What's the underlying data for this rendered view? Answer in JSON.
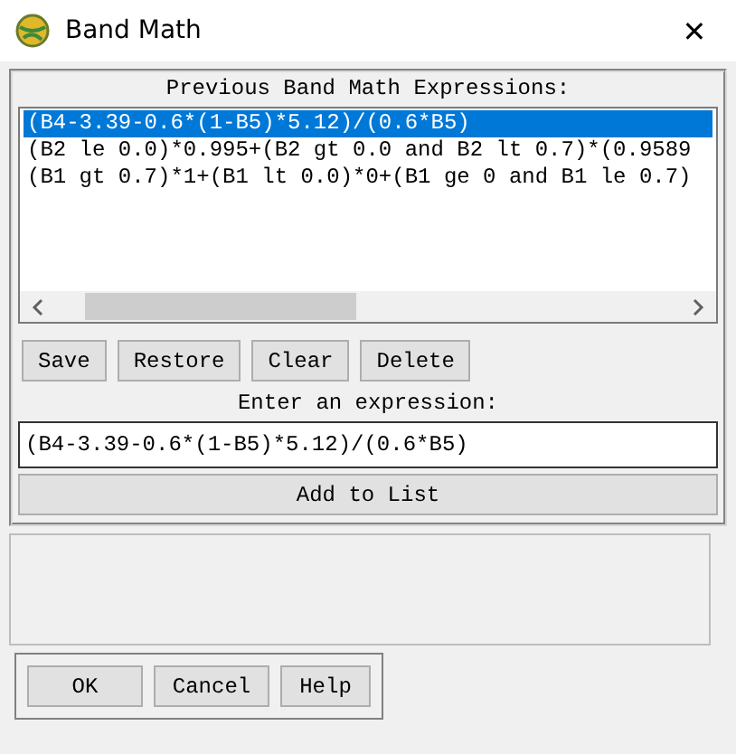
{
  "window": {
    "title": "Band Math",
    "close": "✕"
  },
  "history": {
    "label": "Previous Band Math Expressions:",
    "items": [
      {
        "text": "(B4-3.39-0.6*(1-B5)*5.12)/(0.6*B5)",
        "selected": true
      },
      {
        "text": "(B2 le 0.0)*0.995+(B2 gt 0.0 and B2 lt 0.7)*(0.9589",
        "selected": false
      },
      {
        "text": "(B1 gt 0.7)*1+(B1 lt 0.0)*0+(B1 ge 0 and B1 le 0.7)",
        "selected": false
      }
    ]
  },
  "list_buttons": [
    "Save",
    "Restore",
    "Clear",
    "Delete"
  ],
  "expression": {
    "label": "Enter an expression:",
    "value": "(B4-3.39-0.6*(1-B5)*5.12)/(0.6*B5)"
  },
  "add_button": "Add to List",
  "dialog_buttons": [
    "OK",
    "Cancel",
    "Help"
  ]
}
